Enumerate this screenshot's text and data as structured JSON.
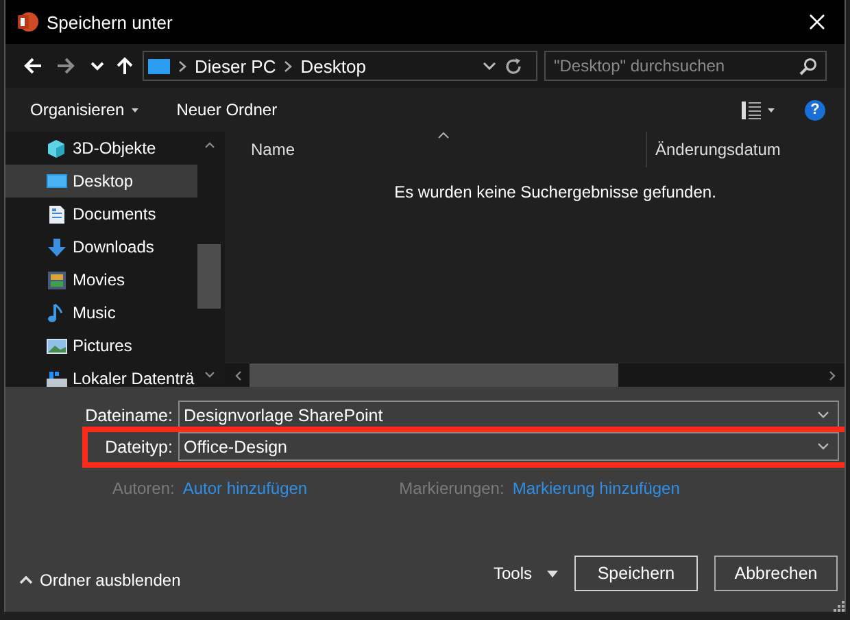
{
  "window": {
    "title": "Speichern unter"
  },
  "navigation": {
    "breadcrumbs": [
      "Dieser PC",
      "Desktop"
    ],
    "search": {
      "placeholder": "\"Desktop\" durchsuchen"
    }
  },
  "toolbar": {
    "organize": "Organisieren",
    "new_folder": "Neuer Ordner",
    "help": "?"
  },
  "sidebar": {
    "items": [
      {
        "label": "3D-Objekte",
        "kind": "objects",
        "selected": false
      },
      {
        "label": "Desktop",
        "kind": "desktop",
        "selected": true
      },
      {
        "label": "Documents",
        "kind": "documents",
        "selected": false
      },
      {
        "label": "Downloads",
        "kind": "downloads",
        "selected": false
      },
      {
        "label": "Movies",
        "kind": "movies",
        "selected": false
      },
      {
        "label": "Music",
        "kind": "music",
        "selected": false
      },
      {
        "label": "Pictures",
        "kind": "pictures",
        "selected": false
      },
      {
        "label": "Lokaler Datenträ",
        "kind": "drive",
        "selected": false
      }
    ]
  },
  "file_list": {
    "columns": [
      "Name",
      "Änderungsdatum"
    ],
    "empty_message": "Es wurden keine Suchergebnisse gefunden."
  },
  "form": {
    "fields": [
      {
        "label": "Dateiname:",
        "value": "Designvorlage SharePoint",
        "highlighted": false
      },
      {
        "label": "Dateityp:",
        "value": "Office-Design",
        "highlighted": true
      }
    ],
    "metadata": [
      {
        "label": "Autoren:",
        "link": "Autor hinzufügen"
      },
      {
        "label": "Markierungen:",
        "link": "Markierung hinzufügen"
      }
    ]
  },
  "footer": {
    "hide_folders": "Ordner ausblenden",
    "tools": "Tools",
    "buttons": [
      "Speichern",
      "Abbrechen"
    ]
  }
}
